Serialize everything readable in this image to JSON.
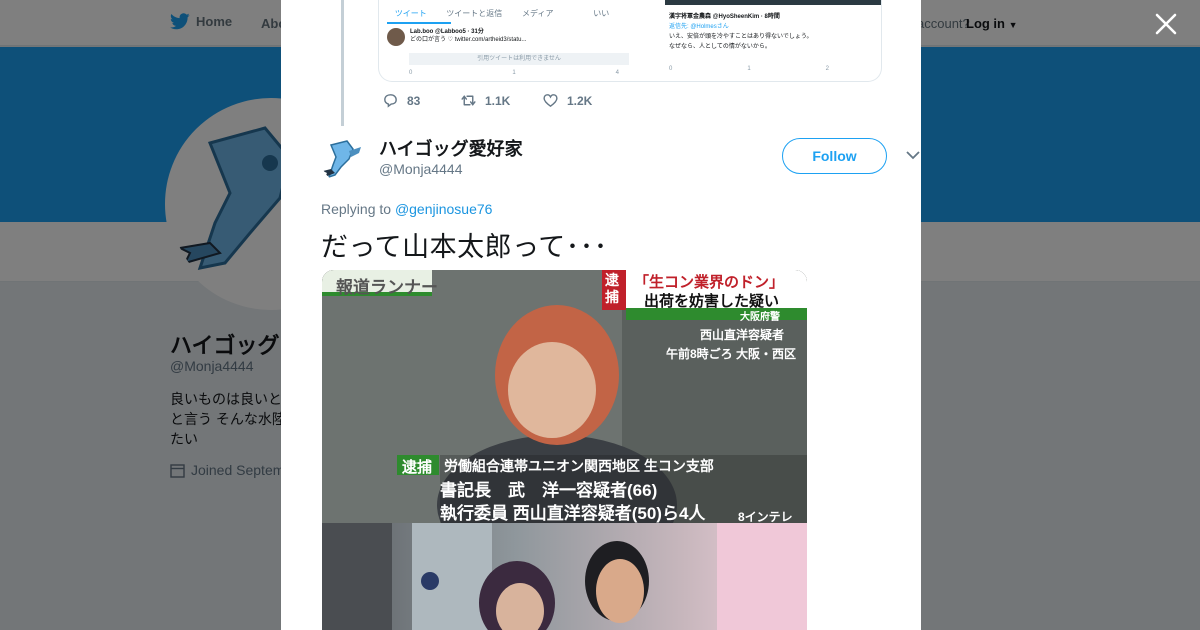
{
  "nav": {
    "home": "Home",
    "about": "Abo",
    "account_prompt": "account?",
    "login": "Log in"
  },
  "profile": {
    "name": "ハイゴッグ",
    "handle": "@Monja4444",
    "bio_lines": [
      "良いものは良いと",
      "と言う そんな水陸",
      "たい"
    ],
    "joined": "Joined Septem"
  },
  "modal": {
    "prev_tweet": {
      "screenshot": {
        "tabs": [
          "ツイート",
          "ツイートと返信",
          "メディア",
          "いい"
        ],
        "inner_author": "Lab.boo @Labboo5 · 31分",
        "inner_text": "どの口が言う ♡ twitter.com/artheid3/statu...",
        "quote_unavailable": "引用ツイートは利用できません",
        "inner_counts": [
          "0",
          "1",
          "4"
        ],
        "right_author": "漢字将軍金農森 @HyoSheenKim · 8時間",
        "right_reply_to": "返信先: @Holmesさん",
        "right_text_1": "いえ、安倍が頭を冷やすことはあり得ないでしょう。",
        "right_text_2": "なぜなら、人としての情がないから。",
        "right_counts": [
          "0",
          "1",
          "2"
        ]
      },
      "replies": "83",
      "retweets": "1.1K",
      "likes": "1.2K"
    },
    "author": {
      "name": "ハイゴッグ愛好家",
      "handle": "@Monja4444",
      "follow_label": "Follow"
    },
    "replying_prefix": "Replying to",
    "replying_to": "@genjinosue76",
    "tweet_text": "だって山本太郎って･･･",
    "photo_captions": {
      "channel": "報道ランナー",
      "arrest_badge": "逮捕",
      "headline_1": "「生コン業界のドン」",
      "headline_2": "出荷を妨害した疑い",
      "police": "大阪府警",
      "suspect_name": "西山直洋容疑者",
      "time_place": "午前8時ごろ 大阪・西区",
      "arrest_label": "逮捕",
      "union": "労働組合連帯ユニオン関西地区 生コン支部",
      "line_1": "書記長　武　洋一容疑者(66)",
      "line_2": "執行委員 西山直洋容疑者(50)ら4人",
      "station": "8インテレ"
    }
  },
  "colors": {
    "accent": "#1da1f2",
    "banner": "#1da1f2",
    "overlay": "rgba(0,0,0,0.5)"
  },
  "icons": {
    "close": "close-icon",
    "reply": "reply-icon",
    "retweet": "retweet-icon",
    "like": "heart-icon",
    "more": "chevron-down-icon",
    "bird": "twitter-bird-icon"
  }
}
